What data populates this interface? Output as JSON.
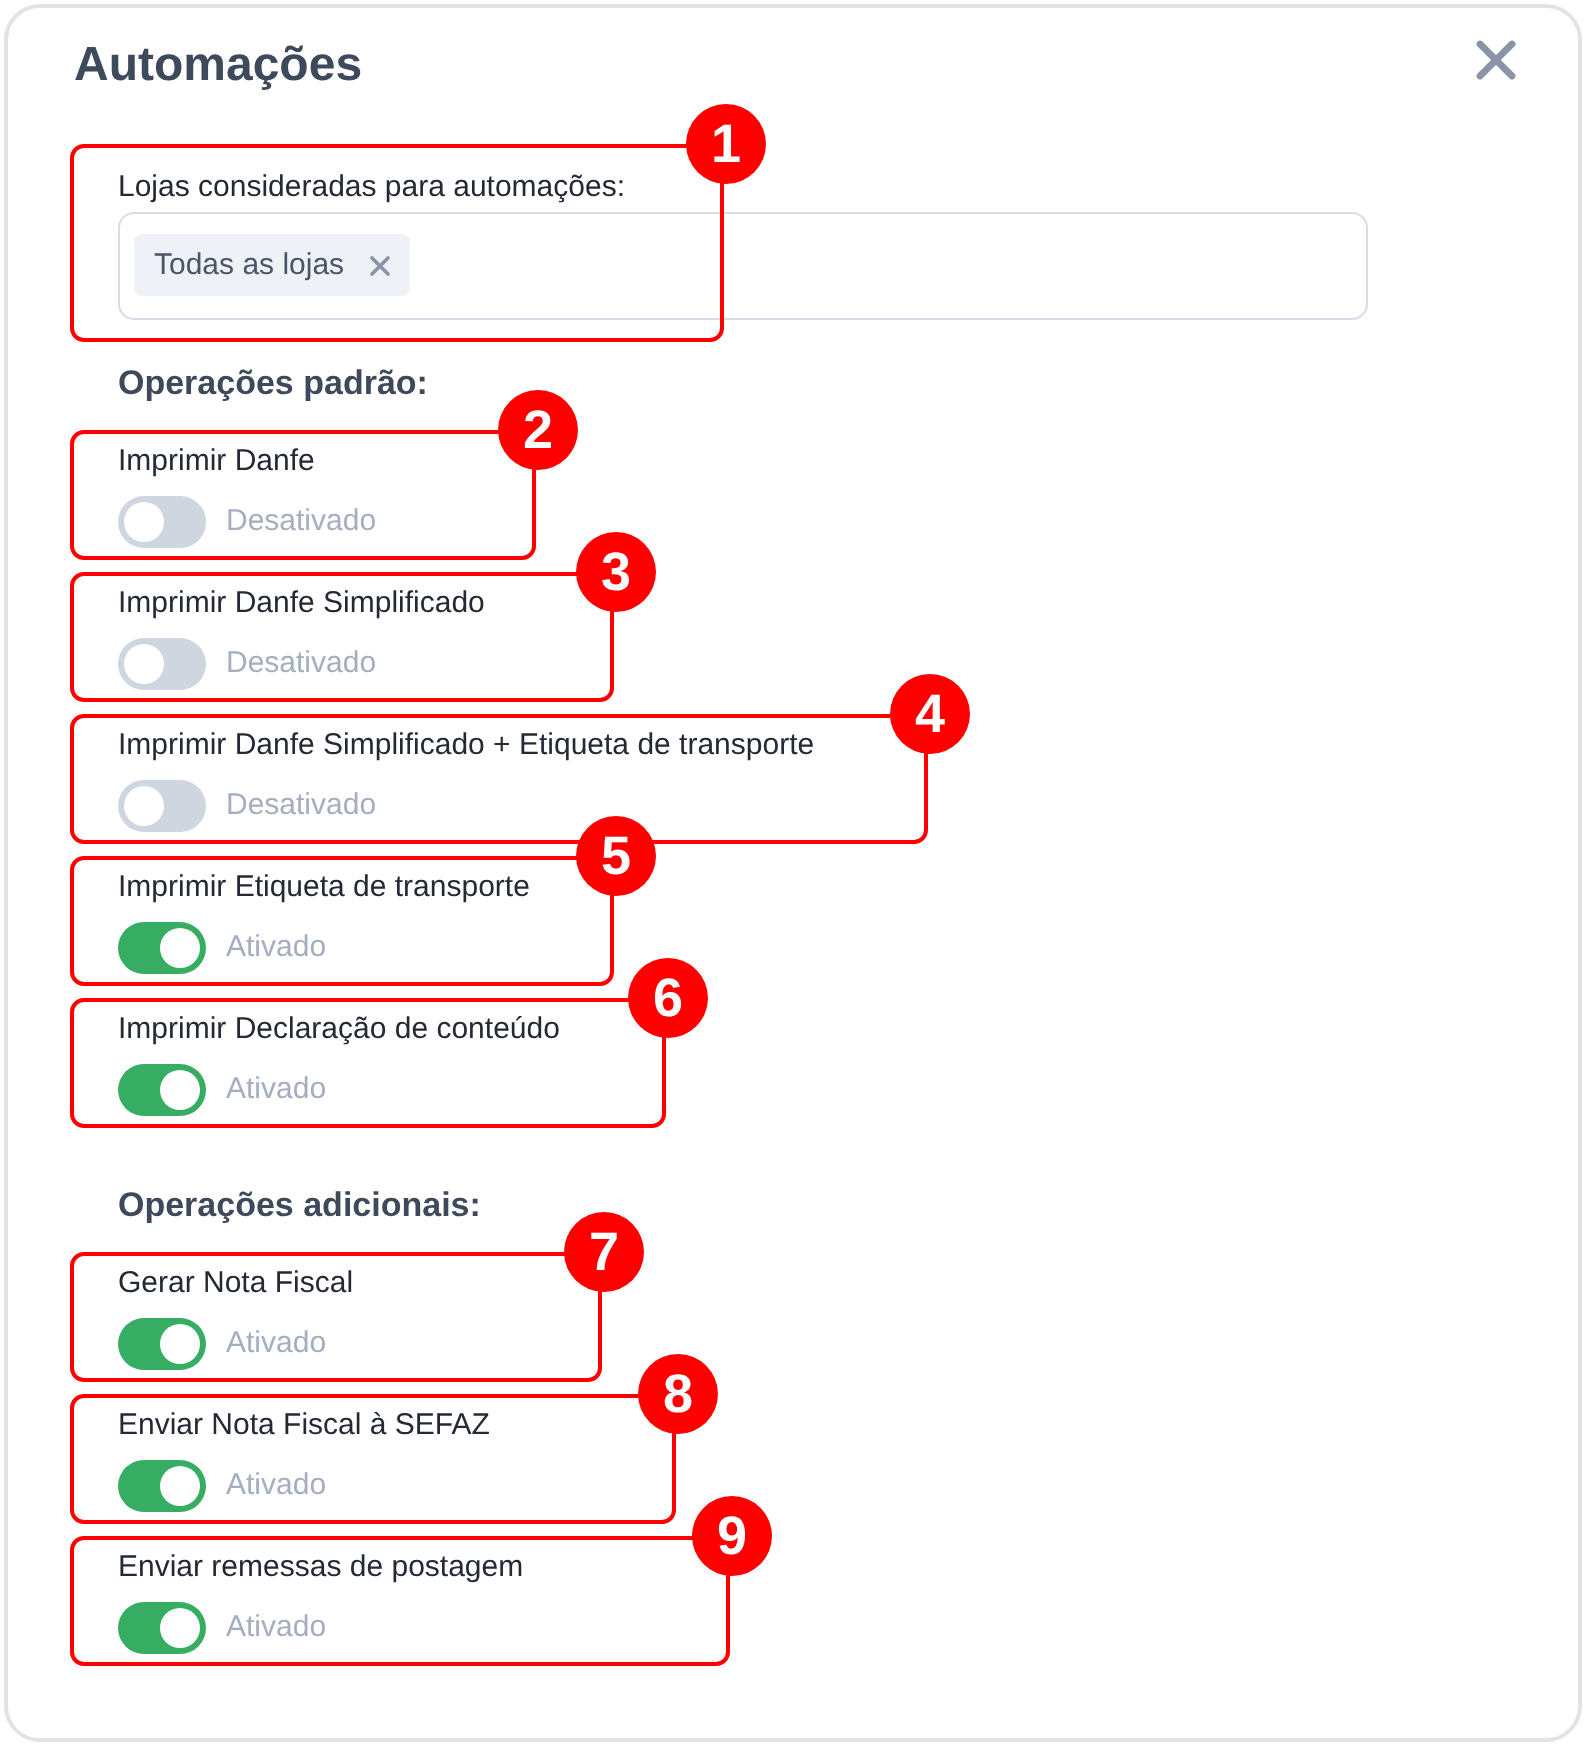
{
  "modal": {
    "title": "Automações"
  },
  "stores": {
    "label": "Lojas consideradas para automações:",
    "tags": [
      {
        "label": "Todas as lojas"
      }
    ],
    "callout": "1"
  },
  "sections": [
    {
      "heading": "Operações padrão:",
      "options": [
        {
          "label": "Imprimir Danfe",
          "on": false,
          "status": "Desativado",
          "callout": "2"
        },
        {
          "label": "Imprimir Danfe Simplificado",
          "on": false,
          "status": "Desativado",
          "callout": "3"
        },
        {
          "label": "Imprimir Danfe Simplificado + Etiqueta de transporte",
          "on": false,
          "status": "Desativado",
          "callout": "4"
        },
        {
          "label": "Imprimir Etiqueta de transporte",
          "on": true,
          "status": "Ativado",
          "callout": "5"
        },
        {
          "label": "Imprimir Declaração de conteúdo",
          "on": true,
          "status": "Ativado",
          "callout": "6"
        }
      ]
    },
    {
      "heading": "Operações adicionais:",
      "options": [
        {
          "label": "Gerar Nota Fiscal",
          "on": true,
          "status": "Ativado",
          "callout": "7"
        },
        {
          "label": "Enviar Nota Fiscal à SEFAZ",
          "on": true,
          "status": "Ativado",
          "callout": "8"
        },
        {
          "label": "Enviar remessas de postagem",
          "on": true,
          "status": "Ativado",
          "callout": "9"
        }
      ]
    }
  ]
}
